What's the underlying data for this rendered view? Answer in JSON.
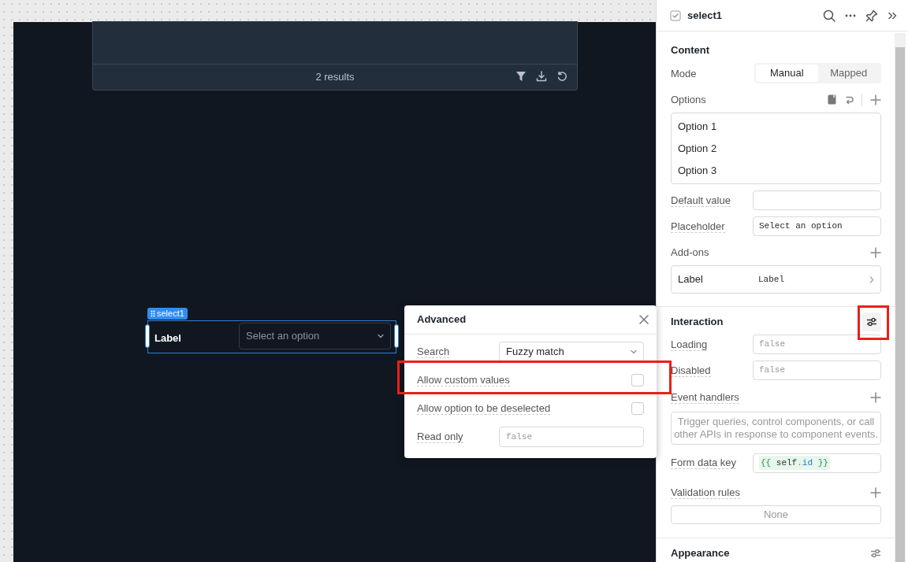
{
  "canvas": {
    "table_footer": {
      "results": "2 results"
    },
    "component": {
      "tag": "select1",
      "label": "Label",
      "placeholder": "Select an option",
      "selected": true
    }
  },
  "advanced_popover": {
    "title": "Advanced",
    "rows": [
      {
        "kind": "select",
        "label": "Search",
        "value": "Fuzzy match"
      },
      {
        "kind": "checkbox",
        "label": "Allow custom values",
        "checked": false
      },
      {
        "kind": "checkbox",
        "label": "Allow option to be deselected",
        "checked": false
      },
      {
        "kind": "code",
        "label": "Read only",
        "placeholder": "false"
      }
    ]
  },
  "inspector": {
    "title": "select1",
    "content": {
      "heading": "Content",
      "mode_label": "Mode",
      "modes": [
        {
          "label": "Manual",
          "selected": true
        },
        {
          "label": "Mapped",
          "selected": false
        }
      ],
      "options_label": "Options",
      "options": [
        "Option 1",
        "Option 2",
        "Option 3"
      ],
      "fields": [
        {
          "label": "Default value"
        },
        {
          "label": "Placeholder",
          "value": "Select an option"
        }
      ],
      "addons_label": "Add-ons",
      "addons": [
        {
          "name": "Label",
          "value": "Label"
        }
      ]
    },
    "interaction": {
      "heading": "Interaction",
      "fields": [
        {
          "label": "Loading",
          "placeholder": "false"
        },
        {
          "label": "Disabled",
          "placeholder": "false"
        }
      ],
      "event_handlers_label": "Event handlers",
      "event_handlers_empty": "Trigger queries, control components, or call other APIs in response to component events.",
      "form_data_key_label": "Form data key",
      "form_data_key": {
        "open": "{{",
        "object": "self",
        "dot": ".",
        "prop": "id",
        "close": "}}"
      },
      "validation_label": "Validation rules",
      "validation_empty": "None"
    },
    "appearance": {
      "heading": "Appearance"
    }
  }
}
